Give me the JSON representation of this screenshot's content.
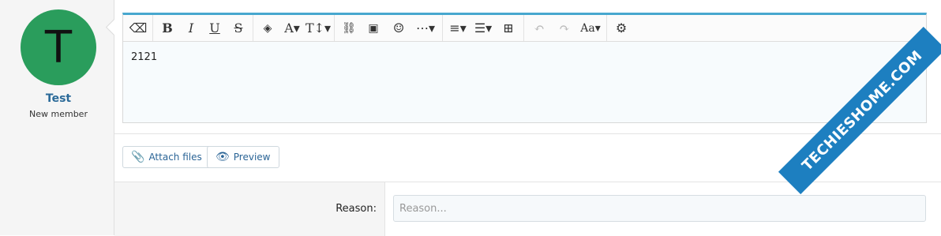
{
  "user": {
    "avatar_letter": "T",
    "avatar_color": "#2a9d5c",
    "name": "Test",
    "title": "New member"
  },
  "toolbar": {
    "buttons": [
      {
        "name": "remove-format-icon",
        "glyph": "⌫"
      },
      {
        "name": "bold-icon",
        "glyph": "B"
      },
      {
        "name": "italic-icon",
        "glyph": "I"
      },
      {
        "name": "underline-icon",
        "glyph": "U"
      },
      {
        "name": "strikethrough-icon",
        "glyph": "S"
      },
      {
        "name": "color-icon",
        "glyph": "💧"
      },
      {
        "name": "font-family-icon",
        "glyph": "A▾"
      },
      {
        "name": "font-size-icon",
        "glyph": "T↕▾"
      },
      {
        "name": "link-icon",
        "glyph": "🔗"
      },
      {
        "name": "image-icon",
        "glyph": "🖼"
      },
      {
        "name": "smilie-icon",
        "glyph": "☺"
      },
      {
        "name": "more-icon",
        "glyph": "⋯▾"
      },
      {
        "name": "align-icon",
        "glyph": "≡▾"
      },
      {
        "name": "list-icon",
        "glyph": "☰▾"
      },
      {
        "name": "table-icon",
        "glyph": "⊞"
      },
      {
        "name": "undo-icon",
        "glyph": "↶"
      },
      {
        "name": "redo-icon",
        "glyph": "↷"
      },
      {
        "name": "styles-icon",
        "glyph": "Aa▾"
      },
      {
        "name": "settings-icon",
        "glyph": "⚙"
      }
    ]
  },
  "editor": {
    "content": "2121"
  },
  "actions": {
    "attach_label": "Attach files",
    "preview_label": "Preview"
  },
  "reason": {
    "label": "Reason:",
    "placeholder": "Reason...",
    "value": ""
  },
  "watermark": {
    "text": "TECHIESHOME.COM"
  },
  "colors": {
    "accent": "#47a7cf",
    "link": "#2a6496",
    "watermark_bg": "#1d7fc0"
  }
}
